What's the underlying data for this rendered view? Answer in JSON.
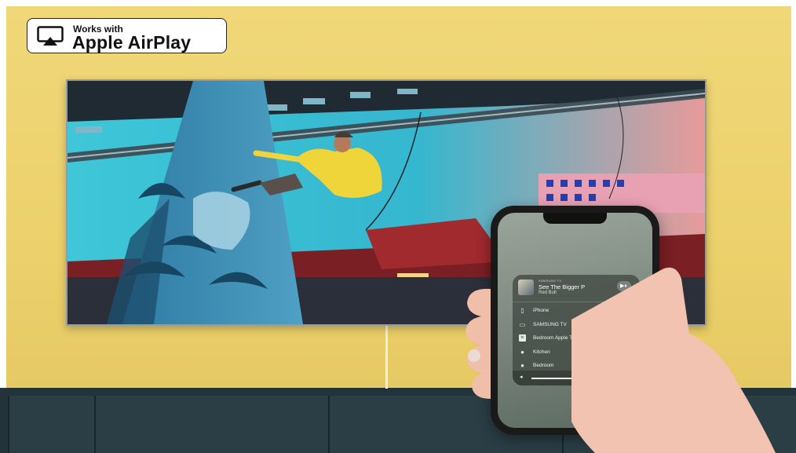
{
  "badge": {
    "line1": "Works with",
    "line2": "Apple AirPlay",
    "icon": "airplay-icon"
  },
  "colors": {
    "wall": "#ecd16c",
    "stand": "#23333a",
    "panel": "#414842",
    "accent": "#ffffff"
  },
  "airplay_menu": {
    "now_playing": {
      "device": "SAMSUNG TV",
      "title": "See The Bigger P",
      "artist": "Red Bull",
      "control_icon": "play-pause-icon"
    },
    "devices": [
      {
        "label": "iPhone",
        "icon": "iphone-icon",
        "selected": false
      },
      {
        "label": "SAMSUNG TV",
        "icon": "tv-icon",
        "selected": true
      },
      {
        "label": "Bedroom Apple TV",
        "icon": "appletv-icon",
        "selected": false
      },
      {
        "label": "Kitchen",
        "icon": "homepod-icon",
        "selected": false
      },
      {
        "label": "Bedroom",
        "icon": "speaker-icon",
        "selected": false
      }
    ],
    "volume": {
      "level": 0.62,
      "low_icon": "volume-low-icon",
      "high_icon": "volume-high-icon"
    }
  }
}
